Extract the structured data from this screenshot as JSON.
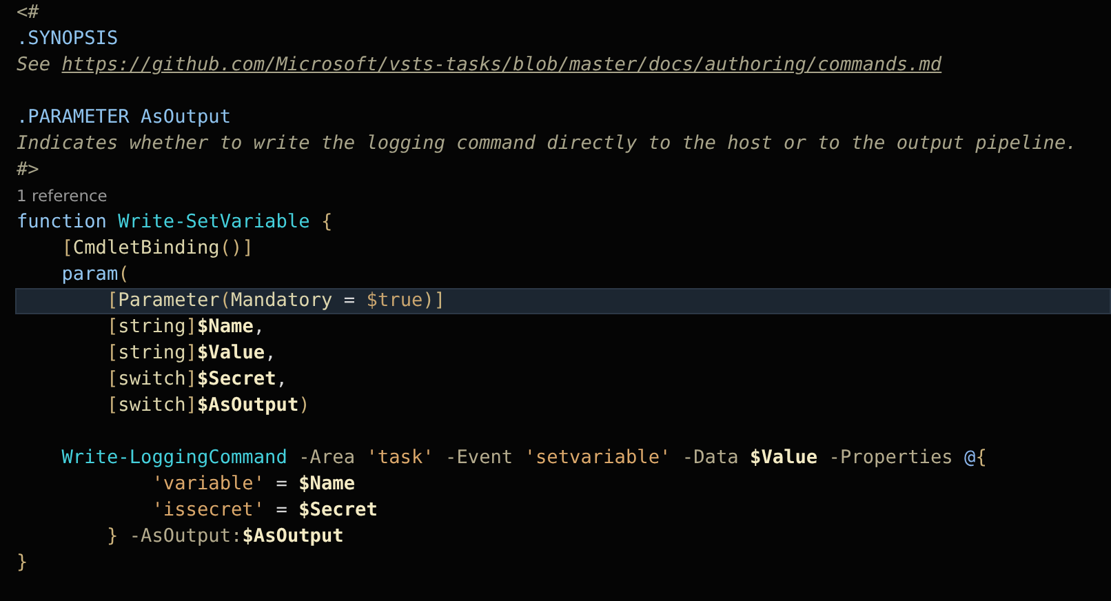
{
  "editor": {
    "lines": [
      {
        "kind": "code",
        "highlighted": false,
        "tokens": [
          {
            "t": "<#",
            "kind": "comment"
          }
        ]
      },
      {
        "kind": "code",
        "highlighted": false,
        "tokens": [
          {
            "t": ".SYNOPSIS",
            "kind": "doc"
          }
        ]
      },
      {
        "kind": "code",
        "highlighted": false,
        "tokens": [
          {
            "t": "See ",
            "kind": "comment"
          },
          {
            "t": "https://github.com/Microsoft/vsts-tasks/blob/master/docs/authoring/commands.md",
            "kind": "link"
          }
        ]
      },
      {
        "kind": "blank",
        "highlighted": false
      },
      {
        "kind": "code",
        "highlighted": false,
        "tokens": [
          {
            "t": ".PARAMETER AsOutput",
            "kind": "doc"
          }
        ]
      },
      {
        "kind": "code",
        "highlighted": false,
        "tokens": [
          {
            "t": "Indicates whether to write the logging command directly to the host or to the output pipeline.",
            "kind": "comment"
          }
        ]
      },
      {
        "kind": "code",
        "highlighted": false,
        "tokens": [
          {
            "t": "#>",
            "kind": "comment"
          }
        ]
      },
      {
        "kind": "codelens",
        "highlighted": false,
        "tokens": [
          {
            "t": "1 reference",
            "kind": "lens"
          }
        ]
      },
      {
        "kind": "code",
        "highlighted": false,
        "tokens": [
          {
            "t": "function",
            "kind": "keyword"
          },
          {
            "t": " Write-SetVariable",
            "kind": "function"
          },
          {
            "t": " {",
            "kind": "punct"
          }
        ]
      },
      {
        "kind": "code",
        "highlighted": false,
        "tokens": [
          {
            "t": "    [",
            "kind": "punct"
          },
          {
            "t": "CmdletBinding",
            "kind": "type"
          },
          {
            "t": "()]",
            "kind": "punct"
          }
        ]
      },
      {
        "kind": "code",
        "highlighted": false,
        "tokens": [
          {
            "t": "    param",
            "kind": "keyword"
          },
          {
            "t": "(",
            "kind": "punct"
          }
        ]
      },
      {
        "kind": "code",
        "highlighted": true,
        "tokens": [
          {
            "t": "        [",
            "kind": "punct"
          },
          {
            "t": "Parameter",
            "kind": "type"
          },
          {
            "t": "(",
            "kind": "punct"
          },
          {
            "t": "Mandatory",
            "kind": "type"
          },
          {
            "t": " = ",
            "kind": "op"
          },
          {
            "t": "$true",
            "kind": "const"
          },
          {
            "t": ")]",
            "kind": "punct"
          }
        ]
      },
      {
        "kind": "code",
        "highlighted": false,
        "tokens": [
          {
            "t": "        [",
            "kind": "punct"
          },
          {
            "t": "string",
            "kind": "type"
          },
          {
            "t": "]",
            "kind": "punct"
          },
          {
            "t": "$Name",
            "kind": "variable"
          },
          {
            "t": ",",
            "kind": "op"
          }
        ]
      },
      {
        "kind": "code",
        "highlighted": false,
        "tokens": [
          {
            "t": "        [",
            "kind": "punct"
          },
          {
            "t": "string",
            "kind": "type"
          },
          {
            "t": "]",
            "kind": "punct"
          },
          {
            "t": "$Value",
            "kind": "variable"
          },
          {
            "t": ",",
            "kind": "op"
          }
        ]
      },
      {
        "kind": "code",
        "highlighted": false,
        "tokens": [
          {
            "t": "        [",
            "kind": "punct"
          },
          {
            "t": "switch",
            "kind": "type"
          },
          {
            "t": "]",
            "kind": "punct"
          },
          {
            "t": "$Secret",
            "kind": "variable"
          },
          {
            "t": ",",
            "kind": "op"
          }
        ]
      },
      {
        "kind": "code",
        "highlighted": false,
        "tokens": [
          {
            "t": "        [",
            "kind": "punct"
          },
          {
            "t": "switch",
            "kind": "type"
          },
          {
            "t": "]",
            "kind": "punct"
          },
          {
            "t": "$AsOutput",
            "kind": "variable"
          },
          {
            "t": ")",
            "kind": "punct"
          }
        ]
      },
      {
        "kind": "blank",
        "highlighted": false
      },
      {
        "kind": "code",
        "highlighted": false,
        "tokens": [
          {
            "t": "    Write-LoggingCommand",
            "kind": "function"
          },
          {
            "t": " -Area ",
            "kind": "param"
          },
          {
            "t": "'task'",
            "kind": "string"
          },
          {
            "t": " -Event ",
            "kind": "param"
          },
          {
            "t": "'setvariable'",
            "kind": "string"
          },
          {
            "t": " -Data ",
            "kind": "param"
          },
          {
            "t": "$Value",
            "kind": "variable"
          },
          {
            "t": " -Properties ",
            "kind": "param"
          },
          {
            "t": "@",
            "kind": "at"
          },
          {
            "t": "{",
            "kind": "punct"
          }
        ]
      },
      {
        "kind": "code",
        "highlighted": false,
        "tokens": [
          {
            "t": "            'variable'",
            "kind": "string"
          },
          {
            "t": " = ",
            "kind": "op"
          },
          {
            "t": "$Name",
            "kind": "variable"
          }
        ]
      },
      {
        "kind": "code",
        "highlighted": false,
        "tokens": [
          {
            "t": "            'issecret'",
            "kind": "string"
          },
          {
            "t": " = ",
            "kind": "op"
          },
          {
            "t": "$Secret",
            "kind": "variable"
          }
        ]
      },
      {
        "kind": "code",
        "highlighted": false,
        "tokens": [
          {
            "t": "        }",
            "kind": "punct"
          },
          {
            "t": " -AsOutput:",
            "kind": "param"
          },
          {
            "t": "$AsOutput",
            "kind": "variable"
          }
        ]
      },
      {
        "kind": "code",
        "highlighted": false,
        "tokens": [
          {
            "t": "}",
            "kind": "punct"
          }
        ]
      }
    ]
  }
}
